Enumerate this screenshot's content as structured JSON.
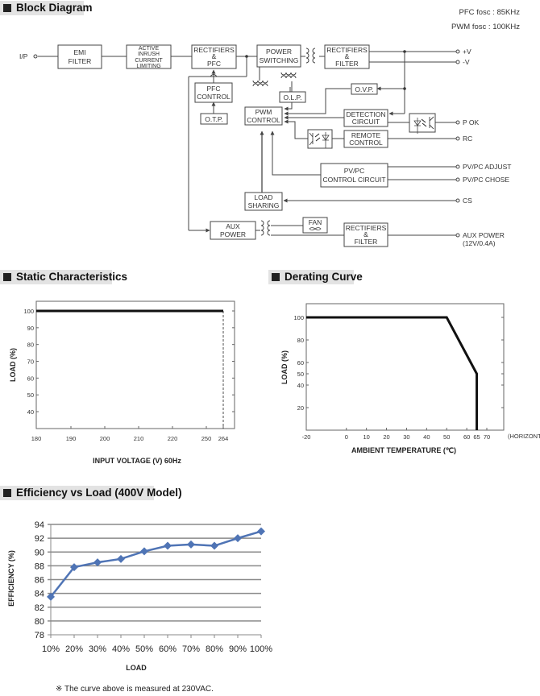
{
  "sections": {
    "block_diagram": "Block Diagram",
    "static": "Static Characteristics",
    "derating": "Derating Curve",
    "efficiency": "Efficiency vs Load (400V Model)"
  },
  "freq": {
    "pfc": "PFC fosc : 85KHz",
    "pwm": "PWM fosc : 100KHz"
  },
  "blocks": {
    "emi": [
      "EMI",
      "FILTER"
    ],
    "inrush": [
      "ACTIVE",
      "INRUSH",
      "CURRENT",
      "LIMITING"
    ],
    "rect_pfc": [
      "RECTIFIERS",
      "&",
      "PFC"
    ],
    "power_sw": [
      "POWER",
      "SWITCHING"
    ],
    "rect_filter": [
      "RECTIFIERS",
      "&",
      "FILTER"
    ],
    "pfc_ctrl": [
      "PFC",
      "CONTROL"
    ],
    "otp": "O.T.P.",
    "olp": "O.L.P.",
    "ovp": "O.V.P.",
    "pwm_ctrl": [
      "PWM",
      "CONTROL"
    ],
    "detection": [
      "DETECTION",
      "CIRCUIT"
    ],
    "remote": [
      "REMOTE",
      "CONTROL"
    ],
    "pvpc": [
      "PV/PC",
      "CONTROL  CIRCUIT"
    ],
    "load_sharing": [
      "LOAD",
      "SHARING"
    ],
    "aux_power": [
      "AUX",
      "POWER"
    ],
    "fan": "FAN",
    "aux_rect": [
      "RECTIFIERS",
      "&",
      "FILTER"
    ]
  },
  "terminals": {
    "ip": "I/P",
    "pv": "+V",
    "nv": "-V",
    "pok": "P OK",
    "rc": "RC",
    "pvpc_adjust": "PV/PC ADJUST",
    "pvpc_chose": "PV/PC CHOSE",
    "cs": "CS",
    "aux_power": "AUX POWER",
    "aux_power_rating": "(12V/0.4A)"
  },
  "note": "※ The curve above is measured at 230VAC.",
  "chart_data": [
    {
      "id": "static",
      "type": "line",
      "title": "Static Characteristics",
      "xlabel": "INPUT VOLTAGE (V) 60Hz",
      "ylabel": "LOAD (%)",
      "x_tick_labels": [
        "180",
        "190",
        "200",
        "210",
        "220",
        "250",
        "264"
      ],
      "y_tick_labels": [
        "100",
        "90",
        "80",
        "70",
        "60",
        "50",
        "40"
      ],
      "y_ticks": [
        100,
        90,
        80,
        70,
        60,
        50,
        40
      ],
      "ylim": [
        30,
        105
      ],
      "series": [
        {
          "name": "Load",
          "x_labels": [
            "180",
            "264"
          ],
          "values": [
            100,
            100
          ]
        }
      ],
      "annotations": [
        {
          "type": "dashed-vertical",
          "x_label": "264",
          "from": 100,
          "to": 30
        }
      ],
      "grid": false
    },
    {
      "id": "derating",
      "type": "line",
      "title": "Derating Curve",
      "xlabel": "AMBIENT TEMPERATURE (℃)",
      "x_suffix": "(HORIZONTAL)",
      "ylabel": "LOAD (%)",
      "x_ticks": [
        -20,
        0,
        10,
        20,
        30,
        40,
        50,
        60,
        65,
        70
      ],
      "y_ticks": [
        100,
        80,
        60,
        50,
        40,
        20
      ],
      "xlim": [
        -20,
        75
      ],
      "ylim": [
        0,
        112
      ],
      "series": [
        {
          "name": "Load",
          "x": [
            -20,
            50,
            65,
            65
          ],
          "y": [
            100,
            100,
            50,
            0
          ]
        }
      ],
      "grid": false
    },
    {
      "id": "efficiency",
      "type": "line",
      "title": "Efficiency vs Load (400V Model)",
      "xlabel": "LOAD",
      "ylabel": "EFFICIENCY (%)",
      "categories": [
        "10%",
        "20%",
        "30%",
        "40%",
        "50%",
        "60%",
        "70%",
        "80%",
        "90%",
        "100%"
      ],
      "series": [
        {
          "name": "Efficiency",
          "values": [
            83.5,
            87.8,
            88.5,
            89.0,
            90.1,
            90.9,
            91.1,
            90.9,
            92.0,
            93.0
          ],
          "color": "#4f74b5"
        }
      ],
      "y_ticks": [
        78,
        80,
        82,
        84,
        86,
        88,
        90,
        92,
        94
      ],
      "ylim": [
        78,
        94
      ],
      "grid": true
    }
  ]
}
